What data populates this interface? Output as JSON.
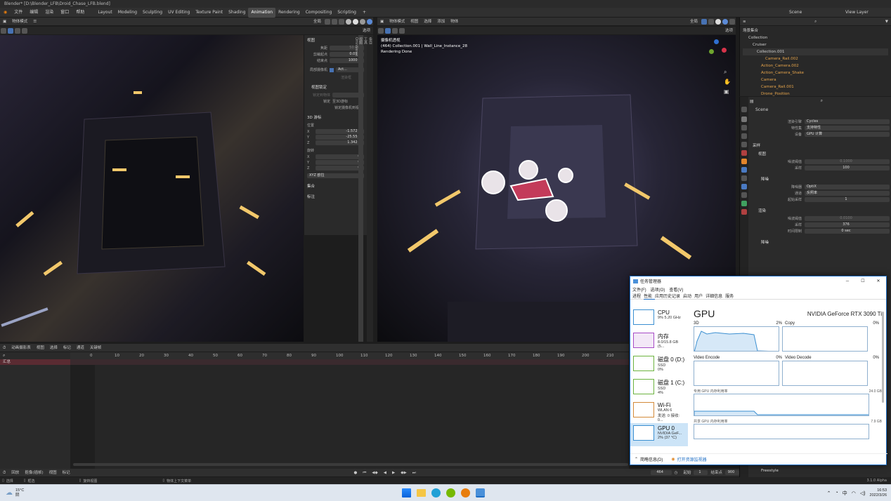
{
  "window": {
    "title": "Blender* [D:\\Blender_LFB\\Droid_Chase_LFB.blend]"
  },
  "menu": {
    "items": [
      "文件",
      "编辑",
      "渲染",
      "窗口",
      "帮助"
    ],
    "workspaces": [
      "Layout",
      "Modeling",
      "Sculpting",
      "UV Editing",
      "Texture Paint",
      "Shading",
      "Animation",
      "Rendering",
      "Compositing",
      "Scripting"
    ],
    "active_workspace": "Animation",
    "scene": "Scene",
    "view_layer": "View Layer"
  },
  "left_viewport": {
    "mode": "物体模式",
    "view_menu": "视图",
    "select_menu": "选择",
    "sidebar": {
      "view_section": "视图",
      "focal_label": "焦距",
      "focal_value": "50 mm",
      "clip_start_label": "剪裁起点",
      "clip_start_value": "0.01 m",
      "clip_end_label": "结束点",
      "clip_end_value": "1000 m",
      "local_camera_label": "局部摄像机",
      "local_camera_value": "Act...",
      "render_region_label": "渲染框",
      "view_lock_section": "视图锁定",
      "lock_object_label": "锁定到物体",
      "lock_label": "锁定",
      "lock_cursor_label": "至3D游标",
      "lock_camera_label": "锁定摄像机到视...",
      "cursor_section": "3D 游标",
      "location_label": "位置",
      "loc_x": "-1.572 m",
      "loc_y": "-25.55 m",
      "loc_z": "1.342 m",
      "rotation_label": "旋转",
      "rot_x": "0°",
      "rot_y": "0°",
      "rot_z": "0°",
      "rotation_mode": "XYZ 欧拉",
      "collection_section": "集合",
      "annotation_section": "标注"
    },
    "tabs": [
      "条目",
      "工具",
      "视图",
      "Omniverse"
    ]
  },
  "right_viewport": {
    "mode": "物体模式",
    "menus": [
      "视图",
      "选择",
      "添加",
      "物体"
    ],
    "global": "全局",
    "select_label": "选项",
    "info_line1": "摄像机透视",
    "info_line2": "(464) Collection.001 | Wall_Line_Instance_28",
    "info_line3": "Rendering Done"
  },
  "outliner": {
    "root": "场景集合",
    "items": [
      "Collection",
      "Cruiser",
      "Collection.001",
      "Camera_Rail.002",
      "Action_Camera.002",
      "Action_Camera_Shake",
      "Camera",
      "Camera_Rail.001",
      "Drone_Position"
    ]
  },
  "properties": {
    "scene": "Scene",
    "render_engine_label": "渲染引擎",
    "render_engine": "Cycles",
    "feature_set_label": "特性集",
    "feature_set": "支持特性",
    "device_label": "设备",
    "device": "GPU 计算",
    "sampling": "采样",
    "viewport": "视图",
    "noise_threshold_label": "噪波阈值",
    "noise_threshold_vp": "0.1000",
    "samples_label": "采样",
    "samples_vp": "100",
    "denoise": "降噪",
    "denoiser_label": "降噪器",
    "denoiser": "OptiX",
    "passes_label": "通道",
    "passes": "反照率",
    "start_sample_label": "起始采样",
    "start_sample": "1",
    "render": "渲染",
    "noise_threshold_r": "0.0100",
    "samples_r": "376",
    "time_limit_label": "时间限制",
    "time_limit": "0 sec",
    "denoise2": "降噪",
    "freestyle": "Freestyle"
  },
  "timeline": {
    "editor": "动画摄影表",
    "menus": [
      "视图",
      "选择",
      "标记",
      "通道",
      "关键帧"
    ],
    "summary": "汇总",
    "ticks": [
      "0",
      "10",
      "20",
      "30",
      "40",
      "50",
      "60",
      "70",
      "80",
      "90",
      "100",
      "110",
      "120",
      "130",
      "140",
      "150",
      "160",
      "170",
      "180",
      "190",
      "200",
      "210"
    ],
    "playback": "回放",
    "keying": "抠像(插帧)",
    "view": "视图",
    "marker": "标记",
    "current_frame": "464",
    "start_label": "起始",
    "start": "1",
    "end_label": "结束点",
    "end": "900"
  },
  "statusbar": {
    "select": "选择",
    "box": "框选",
    "rotate_view": "旋转视图",
    "context_menu": "物体上下文菜单",
    "version": "3.1.0 Alpha"
  },
  "task_manager": {
    "title": "任务管理器",
    "menus": [
      "文件(F)",
      "选项(O)",
      "查看(V)"
    ],
    "tabs": [
      "进程",
      "性能",
      "应用历史记录",
      "启动",
      "用户",
      "详细信息",
      "服务"
    ],
    "active_tab": "性能",
    "sidebar": [
      {
        "name": "CPU",
        "sub": "9% 5.20 GHz",
        "sub2": ""
      },
      {
        "name": "内存",
        "sub": "8.0/15.8 GB (5...",
        "sub2": ""
      },
      {
        "name": "磁盘 0 (D:)",
        "sub": "SSD",
        "sub2": "0%"
      },
      {
        "name": "磁盘 1 (C:)",
        "sub": "SSD",
        "sub2": "4%"
      },
      {
        "name": "Wi-Fi",
        "sub": "WLAN 6",
        "sub2": "发送: 0 接收: 0..."
      },
      {
        "name": "GPU 0",
        "sub": "NVIDIA GeF...",
        "sub2": "2% (37 °C)"
      }
    ],
    "gpu_title": "GPU",
    "gpu_model": "NVIDIA GeForce RTX 3090 Ti",
    "graphs": [
      {
        "label": "3D",
        "pct": "2%"
      },
      {
        "label": "Copy",
        "pct": "0%"
      },
      {
        "label": "Video Encode",
        "pct": "0%"
      },
      {
        "label": "Video Decode",
        "pct": "0%"
      }
    ],
    "dedicated_label": "专用 GPU 内存利用率",
    "dedicated_max": "24.0 GB",
    "shared_label": "共享 GPU 内存利用率",
    "shared_max": "7.9 GB",
    "fewer_details": "简略信息(D)",
    "open_monitor": "打开资源监视器"
  },
  "taskbar": {
    "weather_temp": "15°C",
    "weather_desc": "阴",
    "ime": "中",
    "time": "16:53",
    "date": "2022/3/26"
  }
}
